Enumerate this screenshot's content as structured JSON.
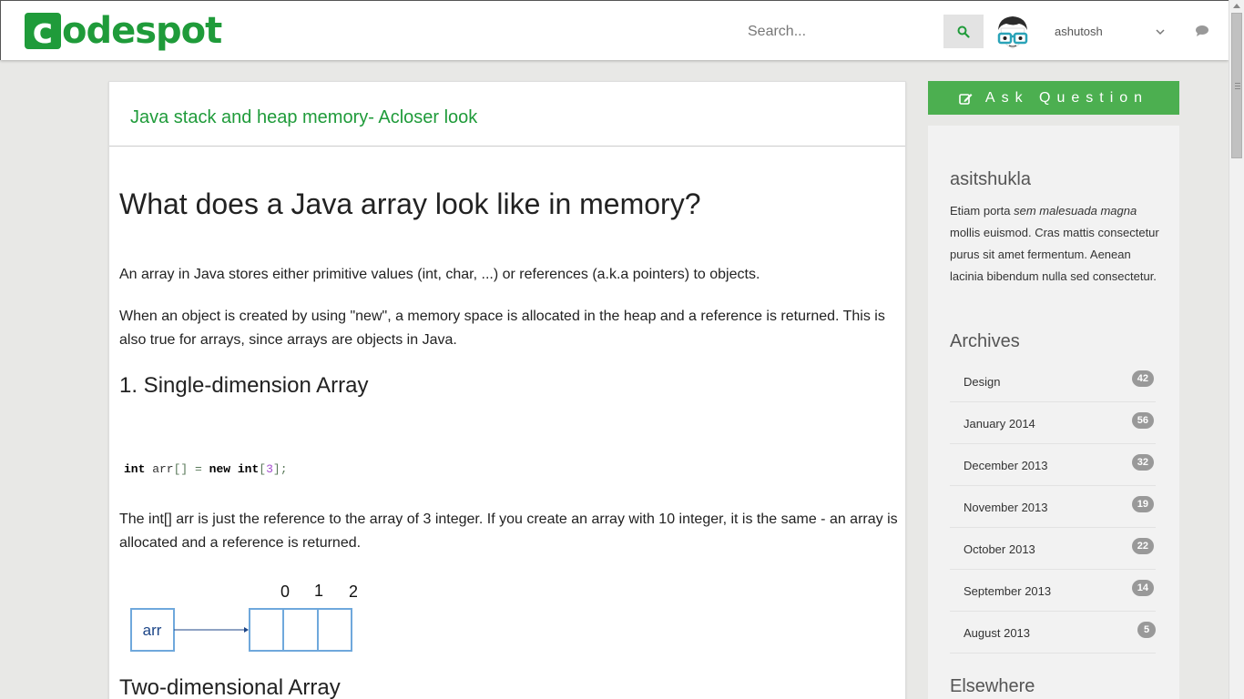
{
  "header": {
    "logo_mark": "c",
    "logo_text": "odespot",
    "search_placeholder": "Search...",
    "username": "ashutosh",
    "colors": {
      "brand": "#1f9b3a"
    }
  },
  "article": {
    "title": "Java stack and heap memory- Acloser look",
    "heading": "What does a Java array look like in memory?",
    "para1": "An array in Java stores either primitive values (int, char, ...) or references (a.k.a pointers) to objects.",
    "para2": "When an object is created by using \"new\", a memory space is allocated in the heap and a reference is returned. This is also true for arrays, since arrays are objects in Java.",
    "section1": "1. Single-dimension Array",
    "code": {
      "kw_int1": "int",
      "ident": " arr",
      "brackets": "[]",
      "eq": " = ",
      "kw_new": "new",
      "kw_int2": " int",
      "open": "[",
      "size": "3",
      "close": "];"
    },
    "para3": "The int[] arr is just the reference to the array of 3 integer. If you create an array with 10 integer, it is the same - an array is allocated and a reference is returned.",
    "diagram": {
      "ref_label": "arr",
      "indices": [
        "0",
        "1",
        "2"
      ]
    },
    "section2": "Two-dimensional Array"
  },
  "sidebar": {
    "ask_label": "Ask Question",
    "user": "asitshukla",
    "bio_pre": "Etiam porta ",
    "bio_em": "sem malesuada magna",
    "bio_post": " mollis euismod. Cras mattis consectetur purus sit amet fermentum. Aenean lacinia bibendum nulla sed consectetur.",
    "archives_title": "Archives",
    "archives": [
      {
        "label": "Design",
        "count": "42"
      },
      {
        "label": "January 2014",
        "count": "56"
      },
      {
        "label": "December 2013",
        "count": "32"
      },
      {
        "label": "November 2013",
        "count": "19"
      },
      {
        "label": "October 2013",
        "count": "22"
      },
      {
        "label": "September 2013",
        "count": "14"
      },
      {
        "label": "August 2013",
        "count": "5"
      }
    ],
    "elsewhere_title": "Elsewhere"
  }
}
